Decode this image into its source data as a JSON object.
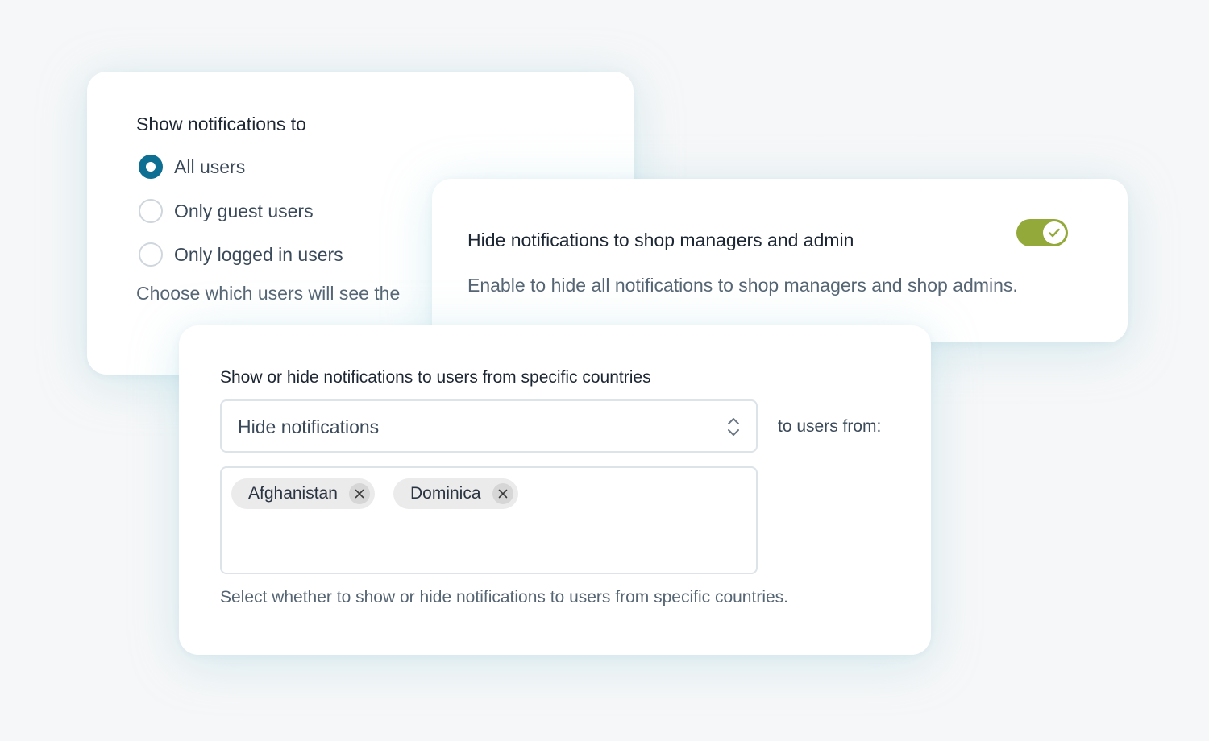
{
  "audience": {
    "title": "Show notifications to",
    "options": [
      {
        "label": "All users",
        "checked": true
      },
      {
        "label": "Only guest users",
        "checked": false
      },
      {
        "label": "Only logged in users",
        "checked": false
      }
    ],
    "help": "Choose which users will see the"
  },
  "admin_toggle": {
    "title": "Hide notifications to shop managers and admin",
    "help": "Enable to hide all notifications to shop managers and shop admins.",
    "enabled": true,
    "color": "#93a93a"
  },
  "countries": {
    "title": "Show or hide notifications to users from specific countries",
    "mode_value": "Hide notifications",
    "to_users_label": "to users from:",
    "selected": [
      {
        "label": "Afghanistan"
      },
      {
        "label": "Dominica"
      }
    ],
    "help": "Select whether to show or hide notifications to users from specific countries."
  },
  "colors": {
    "radio_accent": "#0f6f93",
    "toggle_on": "#93a93a"
  }
}
